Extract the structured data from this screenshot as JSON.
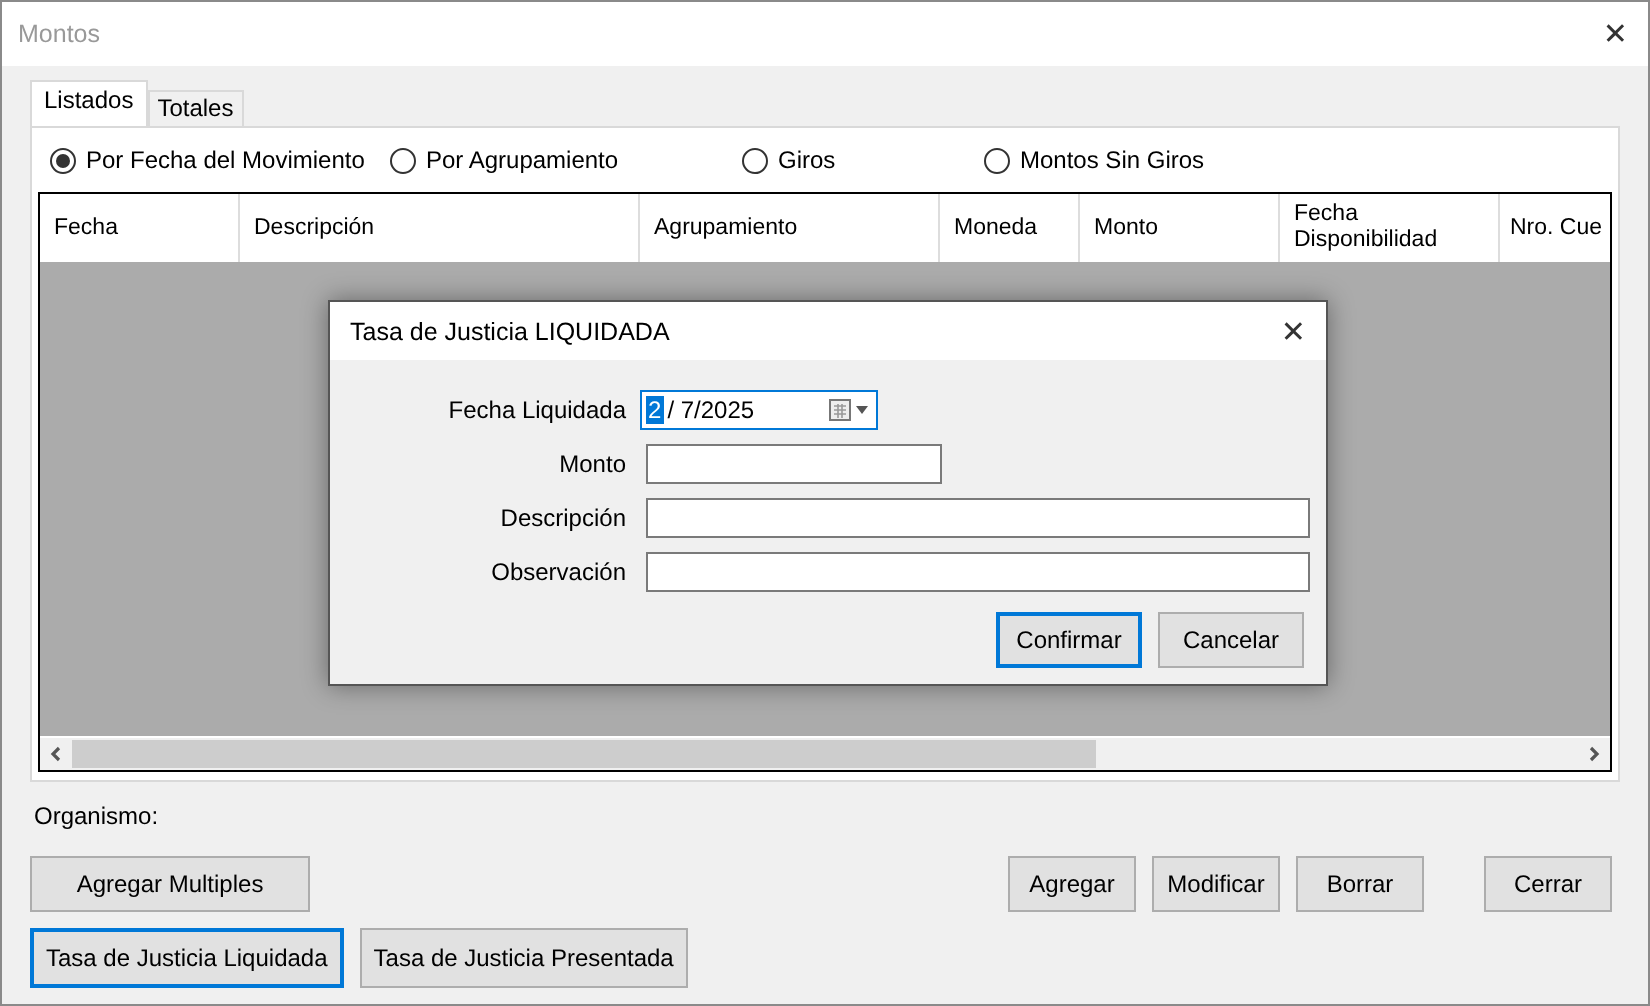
{
  "window": {
    "title": "Montos",
    "close": "✕"
  },
  "tabs": [
    {
      "label": "Listados",
      "selected": true
    },
    {
      "label": "Totales",
      "selected": false
    }
  ],
  "filters": [
    {
      "label": "Por Fecha del Movimiento",
      "selected": true
    },
    {
      "label": "Por Agrupamiento",
      "selected": false
    },
    {
      "label": "Giros",
      "selected": false
    },
    {
      "label": "Montos Sin Giros",
      "selected": false
    }
  ],
  "table": {
    "columns": [
      {
        "label": "Fecha"
      },
      {
        "label": "Descripción"
      },
      {
        "label": "Agrupamiento"
      },
      {
        "label": "Moneda"
      },
      {
        "label": "Monto"
      },
      {
        "label": "Fecha Disponibilidad"
      },
      {
        "label": "Nro. Cue"
      }
    ]
  },
  "organismo_label": "Organismo:",
  "left_buttons": [
    [
      {
        "label": "Agregar Multiples",
        "focused": false
      }
    ],
    [
      {
        "label": "Tasa de Justicia Liquidada",
        "focused": true
      },
      {
        "label": "Tasa de Justicia Presentada",
        "focused": false
      }
    ]
  ],
  "right_buttons": [
    {
      "label": "Agregar",
      "focused": false
    },
    {
      "label": "Modificar",
      "focused": false
    },
    {
      "label": "Borrar",
      "focused": false
    },
    {
      "label": "Cerrar",
      "focused": false
    }
  ],
  "dialog": {
    "title": "Tasa de Justicia LIQUIDADA",
    "close": "✕",
    "fields": [
      {
        "kind": "date",
        "label": "Fecha Liquidada",
        "selected_text": "2",
        "value": "/ 7/2025"
      },
      {
        "kind": "short_text",
        "label": "Monto"
      },
      {
        "kind": "text",
        "label": "Descripción"
      },
      {
        "kind": "text",
        "label": "Observación"
      }
    ],
    "buttons": [
      {
        "label": "Confirmar",
        "focused": true
      },
      {
        "label": "Cancelar",
        "focused": false
      }
    ]
  }
}
